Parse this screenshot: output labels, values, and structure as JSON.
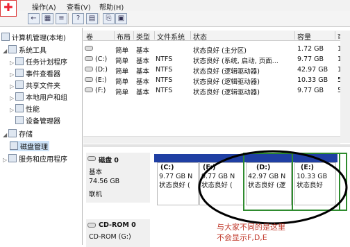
{
  "menu": {
    "action": "操作(A)",
    "view": "查看(V)",
    "help": "帮助(H)"
  },
  "tree": [
    {
      "label": "计算机管理(本地)"
    },
    {
      "label": "系统工具"
    },
    {
      "label": "任务计划程序"
    },
    {
      "label": "事件查看器"
    },
    {
      "label": "共享文件夹"
    },
    {
      "label": "本地用户和组"
    },
    {
      "label": "性能"
    },
    {
      "label": "设备管理器"
    },
    {
      "label": "存储"
    },
    {
      "label": "磁盘管理"
    },
    {
      "label": "服务和应用程序"
    }
  ],
  "columns": {
    "c1": "卷",
    "c2": "布局",
    "c3": "类型",
    "c4": "文件系统",
    "c5": "状态",
    "c6": "容量",
    "c7": "可"
  },
  "volumes": [
    {
      "vol": "",
      "layout": "简单",
      "type": "基本",
      "fs": "",
      "status": "状态良好 (主分区)",
      "cap": "1.72 GB",
      "free": "1."
    },
    {
      "vol": "(C:)",
      "layout": "简单",
      "type": "基本",
      "fs": "NTFS",
      "status": "状态良好 (系统, 启动, 页面...",
      "cap": "9.77 GB",
      "free": "1."
    },
    {
      "vol": "(D:)",
      "layout": "简单",
      "type": "基本",
      "fs": "NTFS",
      "status": "状态良好 (逻辑驱动器)",
      "cap": "42.97 GB",
      "free": "18"
    },
    {
      "vol": "(E:)",
      "layout": "简单",
      "type": "基本",
      "fs": "NTFS",
      "status": "状态良好 (逻辑驱动器)",
      "cap": "10.33 GB",
      "free": "58"
    },
    {
      "vol": "(F:)",
      "layout": "简单",
      "type": "基本",
      "fs": "NTFS",
      "status": "状态良好 (逻辑驱动器)",
      "cap": "9.77 GB",
      "free": "5."
    }
  ],
  "disk0": {
    "name": "磁盘 0",
    "kind": "基本",
    "size": "74.56 GB",
    "state": "联机"
  },
  "partitions": [
    {
      "letter": "(C:)",
      "size": "9.77 GB N",
      "status": "状态良好 ("
    },
    {
      "letter": "(F:)",
      "size": "9.77 GB N",
      "status": "状态良好 ("
    },
    {
      "letter": "(D:)",
      "size": "42.97 GB N",
      "status": "状态良好 (逻"
    },
    {
      "letter": "(E:)",
      "size": "10.33 GB",
      "status": "状态良好"
    }
  ],
  "cdrom": {
    "name": "CD-ROM 0",
    "detail": "CD-ROM (G:)"
  },
  "annotation": {
    "line1": "与大家不同的是这里",
    "line2": "不会显示F,D,E"
  },
  "colors": {
    "bar": "#1f3fa3",
    "highlight": "#2e8b2e",
    "annotation": "#c0392b"
  }
}
